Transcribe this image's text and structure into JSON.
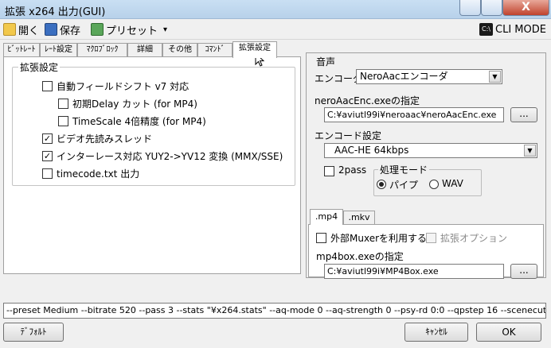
{
  "window": {
    "title": "拡張 x264 出力(GUI)",
    "close_glyph": "X"
  },
  "toolbar": {
    "open": "開く",
    "save": "保存",
    "preset": "プリセット",
    "preset_arrow": "▾",
    "cli_mode": "CLI MODE"
  },
  "tabs": [
    "ﾋﾞｯﾄﾚｰﾄ",
    "ﾚｰﾄ設定",
    "ﾏｸﾛﾌﾞﾛｯｸ",
    "詳細",
    "その他",
    "ｺﾏﾝﾄﾞ",
    "拡張設定"
  ],
  "ext": {
    "group_title": "拡張設定",
    "options": [
      {
        "label": "自動フィールドシフト v7 対応",
        "checked": false
      },
      {
        "label": "初期Delay カット (for MP4)",
        "checked": false
      },
      {
        "label": "TimeScale 4倍精度 (for MP4)",
        "checked": false
      },
      {
        "label": "ビデオ先読みスレッド",
        "checked": true
      },
      {
        "label": "インターレース対応 YUY2->YV12 変換 (MMX/SSE)",
        "checked": true
      },
      {
        "label": "timecode.txt 出力",
        "checked": false
      }
    ]
  },
  "audio": {
    "group_title": "音声",
    "encoder_label": "エンコーダ",
    "encoder_value": "NeroAacエンコーダ",
    "exe_label": "neroAacEnc.exeの指定",
    "exe_path": "C:¥aviutl99i¥neroaac¥neroAacEnc.exe",
    "browse": "...",
    "settings_label": "エンコード設定",
    "settings_value": "AAC-HE 64kbps",
    "twopass": "2pass",
    "mode_title": "処理モード",
    "mode_pipe": "パイプ",
    "mode_wav": "WAV"
  },
  "mux": {
    "tabs": [
      ".mp4",
      ".mkv"
    ],
    "use_external": "外部Muxerを利用する",
    "ext_option": "拡張オプション",
    "exe_label": "mp4box.exeの指定",
    "exe_path": "C:¥aviutl99i¥MP4Box.exe",
    "browse": "..."
  },
  "cmdline": "--preset Medium --bitrate 520 --pass 3 --stats \"¥x264.stats\" --aq-mode 0 --aq-strength 0 --psy-rd 0:0 --qpstep 16 --scenecut",
  "buttons": {
    "default": "ﾃﾞﾌｫﾙﾄ",
    "cancel": "ｷｬﾝｾﾙ",
    "ok": "OK"
  },
  "colors": {
    "titlebar": "#c4dcf2",
    "close": "#c7452f"
  }
}
